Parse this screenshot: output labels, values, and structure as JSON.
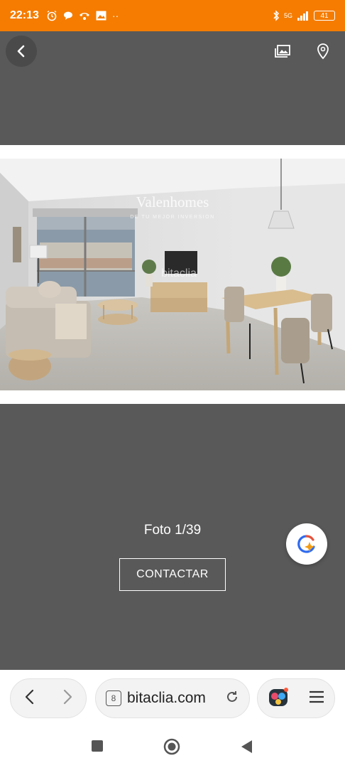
{
  "status_bar": {
    "time": "22:13",
    "network": "5G",
    "battery": "41",
    "left_icons": [
      "alarm-icon",
      "chat-icon",
      "phone-icon",
      "gallery-icon"
    ],
    "overflow": "··",
    "right_icons": [
      "bluetooth-icon",
      "signal-icon",
      "battery-icon"
    ]
  },
  "header": {
    "back_icon": "chevron-left-icon",
    "gallery_icon": "gallery-icon",
    "location_icon": "map-pin-icon"
  },
  "photo": {
    "watermark_brand": "Valenhomes",
    "watermark_sub": "DE TU MEJOR INVERSION",
    "watermark_site": "bitaclia"
  },
  "gallery": {
    "counter": "Foto 1/39",
    "contact_label": "CONTACTAR"
  },
  "browser": {
    "tab_count": "8",
    "url": "bitaclia.com"
  },
  "colors": {
    "status_bar": "#f57c00",
    "background": "#595959",
    "assistant_blue": "#2f6bf0",
    "assistant_orange": "#f39c12"
  }
}
